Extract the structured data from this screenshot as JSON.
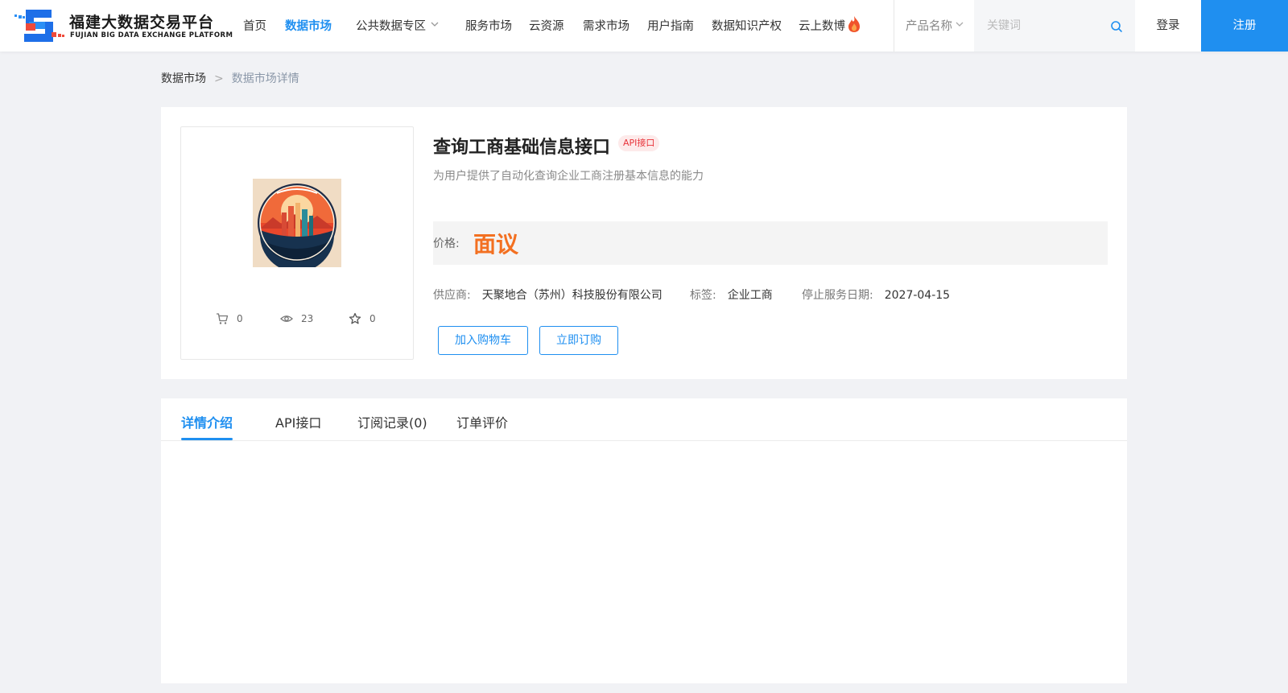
{
  "header": {
    "logo_title": "福建大数据交易平台",
    "logo_subtitle": "FUJIAN BIG DATA EXCHANGE  PLATFORM",
    "nav": [
      {
        "label": "首页"
      },
      {
        "label": "数据市场",
        "active": true
      },
      {
        "label": "公共数据专区",
        "has_dropdown": true
      },
      {
        "label": "服务市场"
      },
      {
        "label": "云资源"
      },
      {
        "label": "需求市场"
      },
      {
        "label": "用户指南"
      },
      {
        "label": "数据知识产权"
      },
      {
        "label": "云上数博",
        "icon": "fire-icon"
      }
    ],
    "search": {
      "type_label": "产品名称",
      "placeholder": "关键词"
    },
    "login_label": "登录",
    "register_label": "注册"
  },
  "breadcrumb": {
    "parent": "数据市场",
    "separator": ">",
    "current": "数据市场详情"
  },
  "product": {
    "title": "查询工商基础信息接口",
    "badge": "API接口",
    "description": "为用户提供了自动化查询企业工商注册基本信息的能力",
    "price_label": "价格:",
    "price_value": "面议",
    "supplier_label": "供应商:",
    "supplier_value": "天聚地合（苏州）科技股份有限公司",
    "tag_label": "标签:",
    "tag_value": "企业工商",
    "stop_date_label": "停止服务日期:",
    "stop_date_value": "2027-04-15",
    "add_cart_label": "加入购物车",
    "buy_now_label": "立即订购",
    "stats": {
      "cart_count": "0",
      "views": "23",
      "favorites": "0"
    }
  },
  "tabs": [
    {
      "label": "详情介绍",
      "active": true
    },
    {
      "label": "API接口"
    },
    {
      "label": "订阅记录(0)"
    },
    {
      "label": "订单评价"
    }
  ],
  "colors": {
    "accent": "#1f8ff0",
    "price": "#f37021",
    "badge_text": "#e8343b",
    "badge_bg": "#fdeaea"
  }
}
